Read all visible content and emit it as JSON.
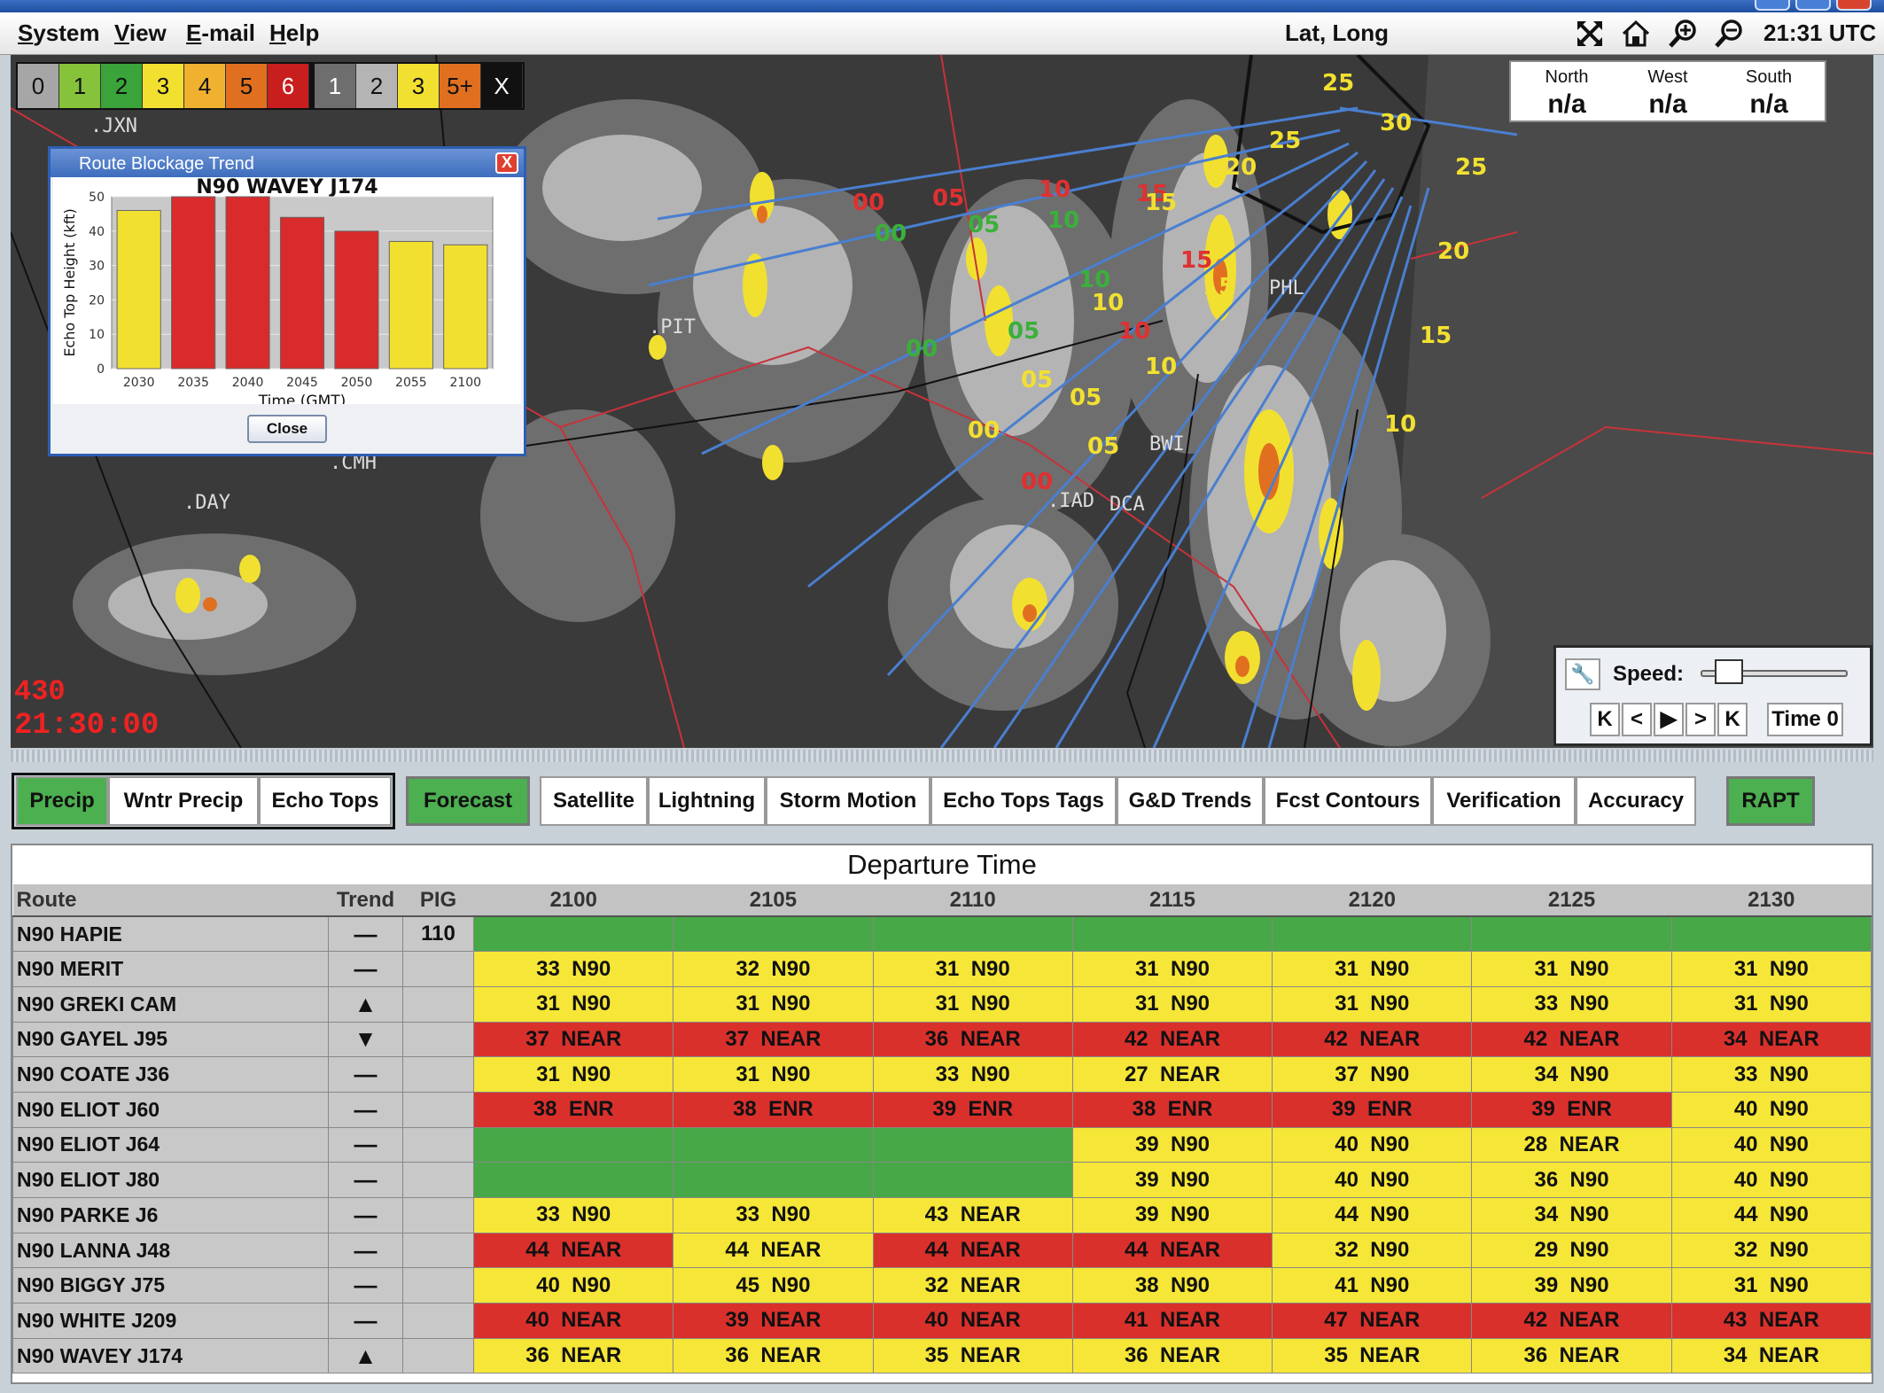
{
  "menubar": {
    "items": [
      {
        "label": "System",
        "u": "S"
      },
      {
        "label": "View",
        "u": "V"
      },
      {
        "label": "E-mail",
        "u": "E"
      },
      {
        "label": "Help",
        "u": "H"
      }
    ],
    "coords_label": "Lat, Long",
    "clock": "21:31 UTC"
  },
  "legend": {
    "precip": [
      {
        "t": "0",
        "c": "#a6a6a6"
      },
      {
        "t": "1",
        "c": "#86c33a"
      },
      {
        "t": "2",
        "c": "#3aa43a"
      },
      {
        "t": "3",
        "c": "#f2e030"
      },
      {
        "t": "4",
        "c": "#f0b030"
      },
      {
        "t": "5",
        "c": "#e07020"
      },
      {
        "t": "6",
        "c": "#c81e1e"
      }
    ],
    "echo": [
      {
        "t": "1",
        "c": "#6e6e6e"
      },
      {
        "t": "2",
        "c": "#b4b4b4"
      },
      {
        "t": "3",
        "c": "#f2e030"
      },
      {
        "t": "5+",
        "c": "#e07020"
      }
    ],
    "clear": "X"
  },
  "direction_box": [
    {
      "label": "North",
      "value": "n/a"
    },
    {
      "label": "West",
      "value": "n/a"
    },
    {
      "label": "South",
      "value": "n/a"
    }
  ],
  "map": {
    "timestamp": "21:30:00",
    "overlay_value": "430",
    "airports": [
      "JXN",
      "PIT",
      "CMH",
      "DAY",
      "PHL",
      "IAD",
      "DCA",
      "BWI"
    ],
    "contour_labels": [
      {
        "t": "00",
        "c": "#e03030"
      },
      {
        "t": "05",
        "c": "#e03030"
      },
      {
        "t": "10",
        "c": "#e03030"
      },
      {
        "t": "15",
        "c": "#e03030"
      },
      {
        "t": "00",
        "c": "#3ab03a"
      },
      {
        "t": "05",
        "c": "#3ab03a"
      },
      {
        "t": "10",
        "c": "#3ab03a"
      },
      {
        "t": "05",
        "c": "#f2e030"
      },
      {
        "t": "10",
        "c": "#f2e030"
      },
      {
        "t": "15",
        "c": "#f2e030"
      },
      {
        "t": "20",
        "c": "#f2e030"
      },
      {
        "t": "25",
        "c": "#f2e030"
      },
      {
        "t": "30",
        "c": "#f2e030"
      }
    ]
  },
  "popup": {
    "title": "Route Blockage Trend",
    "close_x": "X",
    "button": "Close",
    "chart_data": {
      "type": "bar",
      "title": "N90 WAVEY J174",
      "xlabel": "Time (GMT)",
      "ylabel": "Echo Top Height (kft)",
      "categories": [
        "2030",
        "2035",
        "2040",
        "2045",
        "2050",
        "2055",
        "2100"
      ],
      "values": [
        46,
        50,
        50,
        44,
        40,
        37,
        36
      ],
      "colors": [
        "#f2e030",
        "#d92b2b",
        "#d92b2b",
        "#d92b2b",
        "#d92b2b",
        "#f2e030",
        "#f2e030"
      ],
      "ylim": [
        0,
        50
      ],
      "yticks": [
        0,
        10,
        20,
        30,
        40,
        50
      ],
      "grid": true
    }
  },
  "player": {
    "speed_label": "Speed:",
    "speed_value": 0.12,
    "buttons": [
      "K",
      "<",
      "▶",
      ">",
      "K"
    ],
    "time_button": "Time 0"
  },
  "tabs": {
    "left_group": [
      "Precip",
      "Wntr Precip",
      "Echo Tops"
    ],
    "forecast": "Forecast",
    "right": [
      "Satellite",
      "Lightning",
      "Storm Motion",
      "Echo Tops Tags",
      "G&D Trends",
      "Fcst Contours",
      "Verification",
      "Accuracy"
    ],
    "rapt": "RAPT",
    "active_color": "#4caf50"
  },
  "table": {
    "title": "Departure Time",
    "headers": [
      "Route",
      "Trend",
      "PIG",
      "2100",
      "2105",
      "2110",
      "2115",
      "2120",
      "2125",
      "2130"
    ],
    "colors": {
      "G": "#46a846",
      "Y": "#f5e637",
      "R": "#d9302c"
    },
    "rows": [
      {
        "route": "N90 HAPIE",
        "trend": "—",
        "pig": "110",
        "cells": [
          [
            "G",
            ""
          ],
          [
            "G",
            ""
          ],
          [
            "G",
            ""
          ],
          [
            "G",
            ""
          ],
          [
            "G",
            ""
          ],
          [
            "G",
            ""
          ],
          [
            "G",
            ""
          ]
        ]
      },
      {
        "route": "N90 MERIT",
        "trend": "—",
        "pig": "",
        "cells": [
          [
            "Y",
            "33  N90"
          ],
          [
            "Y",
            "32  N90"
          ],
          [
            "Y",
            "31  N90"
          ],
          [
            "Y",
            "31  N90"
          ],
          [
            "Y",
            "31  N90"
          ],
          [
            "Y",
            "31  N90"
          ],
          [
            "Y",
            "31  N90"
          ]
        ]
      },
      {
        "route": "N90 GREKI CAM",
        "trend": "▲",
        "pig": "",
        "cells": [
          [
            "Y",
            "31  N90"
          ],
          [
            "Y",
            "31  N90"
          ],
          [
            "Y",
            "31  N90"
          ],
          [
            "Y",
            "31  N90"
          ],
          [
            "Y",
            "31  N90"
          ],
          [
            "Y",
            "33  N90"
          ],
          [
            "Y",
            "31  N90"
          ]
        ]
      },
      {
        "route": "N90 GAYEL J95",
        "trend": "▼",
        "pig": "",
        "cells": [
          [
            "R",
            "37  NEAR"
          ],
          [
            "R",
            "37  NEAR"
          ],
          [
            "R",
            "36  NEAR"
          ],
          [
            "R",
            "42  NEAR"
          ],
          [
            "R",
            "42  NEAR"
          ],
          [
            "R",
            "42  NEAR"
          ],
          [
            "R",
            "34  NEAR"
          ]
        ]
      },
      {
        "route": "N90 COATE J36",
        "trend": "—",
        "pig": "",
        "cells": [
          [
            "Y",
            "31  N90"
          ],
          [
            "Y",
            "31  N90"
          ],
          [
            "Y",
            "33  N90"
          ],
          [
            "Y",
            "27  NEAR"
          ],
          [
            "Y",
            "37  N90"
          ],
          [
            "Y",
            "34  N90"
          ],
          [
            "Y",
            "33  N90"
          ]
        ]
      },
      {
        "route": "N90 ELIOT J60",
        "trend": "—",
        "pig": "",
        "cells": [
          [
            "R",
            "38  ENR"
          ],
          [
            "R",
            "38  ENR"
          ],
          [
            "R",
            "39  ENR"
          ],
          [
            "R",
            "38  ENR"
          ],
          [
            "R",
            "39  ENR"
          ],
          [
            "R",
            "39  ENR"
          ],
          [
            "Y",
            "40  N90"
          ]
        ]
      },
      {
        "route": "N90 ELIOT J64",
        "trend": "—",
        "pig": "",
        "cells": [
          [
            "G",
            ""
          ],
          [
            "G",
            ""
          ],
          [
            "G",
            ""
          ],
          [
            "Y",
            "39  N90"
          ],
          [
            "Y",
            "40  N90"
          ],
          [
            "Y",
            "28  NEAR"
          ],
          [
            "Y",
            "40  N90"
          ]
        ]
      },
      {
        "route": "N90 ELIOT J80",
        "trend": "—",
        "pig": "",
        "cells": [
          [
            "G",
            ""
          ],
          [
            "G",
            ""
          ],
          [
            "G",
            ""
          ],
          [
            "Y",
            "39  N90"
          ],
          [
            "Y",
            "40  N90"
          ],
          [
            "Y",
            "36  N90"
          ],
          [
            "Y",
            "40  N90"
          ]
        ]
      },
      {
        "route": "N90 PARKE J6",
        "trend": "—",
        "pig": "",
        "cells": [
          [
            "Y",
            "33  N90"
          ],
          [
            "Y",
            "33  N90"
          ],
          [
            "Y",
            "43  NEAR"
          ],
          [
            "Y",
            "39  N90"
          ],
          [
            "Y",
            "44  N90"
          ],
          [
            "Y",
            "34  N90"
          ],
          [
            "Y",
            "44  N90"
          ]
        ]
      },
      {
        "route": "N90 LANNA J48",
        "trend": "—",
        "pig": "",
        "cells": [
          [
            "R",
            "44  NEAR"
          ],
          [
            "Y",
            "44  NEAR"
          ],
          [
            "R",
            "44  NEAR"
          ],
          [
            "R",
            "44  NEAR"
          ],
          [
            "Y",
            "32  N90"
          ],
          [
            "Y",
            "29  N90"
          ],
          [
            "Y",
            "32  N90"
          ]
        ]
      },
      {
        "route": "N90 BIGGY J75",
        "trend": "—",
        "pig": "",
        "cells": [
          [
            "Y",
            "40  N90"
          ],
          [
            "Y",
            "45  N90"
          ],
          [
            "Y",
            "32  NEAR"
          ],
          [
            "Y",
            "38  N90"
          ],
          [
            "Y",
            "41  N90"
          ],
          [
            "Y",
            "39  N90"
          ],
          [
            "Y",
            "31  N90"
          ]
        ]
      },
      {
        "route": "N90 WHITE J209",
        "trend": "—",
        "pig": "",
        "cells": [
          [
            "R",
            "40  NEAR"
          ],
          [
            "R",
            "39  NEAR"
          ],
          [
            "R",
            "40  NEAR"
          ],
          [
            "R",
            "41  NEAR"
          ],
          [
            "R",
            "47  NEAR"
          ],
          [
            "R",
            "42  NEAR"
          ],
          [
            "R",
            "43  NEAR"
          ]
        ]
      },
      {
        "route": "N90 WAVEY J174",
        "trend": "▲",
        "pig": "",
        "cells": [
          [
            "Y",
            "36  NEAR"
          ],
          [
            "Y",
            "36  NEAR"
          ],
          [
            "Y",
            "35  NEAR"
          ],
          [
            "Y",
            "36  NEAR"
          ],
          [
            "Y",
            "35  NEAR"
          ],
          [
            "Y",
            "36  NEAR"
          ],
          [
            "Y",
            "34  NEAR"
          ]
        ]
      }
    ]
  }
}
